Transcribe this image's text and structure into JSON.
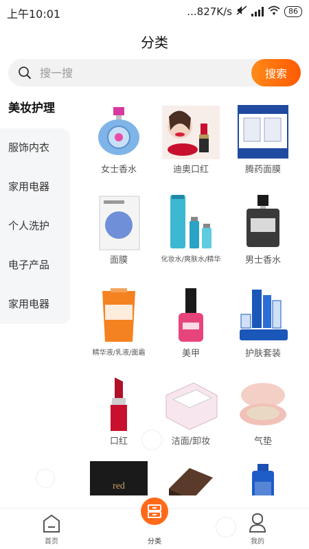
{
  "status_bar": {
    "time": "上午10:01",
    "network_speed": "...827K/s",
    "battery": "86"
  },
  "header": {
    "title": "分类"
  },
  "search": {
    "placeholder": "搜一搜",
    "button_label": "搜索"
  },
  "sidebar": {
    "items": [
      {
        "label": "美妆护理"
      },
      {
        "label": "服饰内衣"
      },
      {
        "label": "家用电器"
      },
      {
        "label": "个人洗护"
      },
      {
        "label": "电子产品"
      },
      {
        "label": "家用电器"
      }
    ]
  },
  "products": [
    {
      "label": "女士香水",
      "icon": "perfume-bottle-icon"
    },
    {
      "label": "迪奥口红",
      "icon": "lipstick-ad-icon"
    },
    {
      "label": "腾药面膜",
      "icon": "mask-box-icon"
    },
    {
      "label": "面膜",
      "icon": "mask-pack-icon"
    },
    {
      "label": "化妆水/爽肤水/精华",
      "icon": "toner-bottles-icon"
    },
    {
      "label": "男士香水",
      "icon": "men-perfume-icon"
    },
    {
      "label": "精华液/乳液/面霜",
      "icon": "sunscreen-tube-icon"
    },
    {
      "label": "美甲",
      "icon": "nail-polish-icon"
    },
    {
      "label": "护肤套装",
      "icon": "skincare-set-icon"
    },
    {
      "label": "口红",
      "icon": "lipstick-icon"
    },
    {
      "label": "洁面/卸妆",
      "icon": "cotton-pads-icon"
    },
    {
      "label": "气垫",
      "icon": "cushion-compact-icon"
    },
    {
      "label": "",
      "icon": "red-box-icon"
    },
    {
      "label": "",
      "icon": "eyeshadow-palette-icon"
    },
    {
      "label": "",
      "icon": "blue-bottle-icon"
    }
  ],
  "bottom_nav": {
    "home": "首页",
    "category": "分类",
    "mine": "我的"
  },
  "colors": {
    "accent": "#ff6a1a",
    "sidebar_bg": "#f5f6f8"
  }
}
